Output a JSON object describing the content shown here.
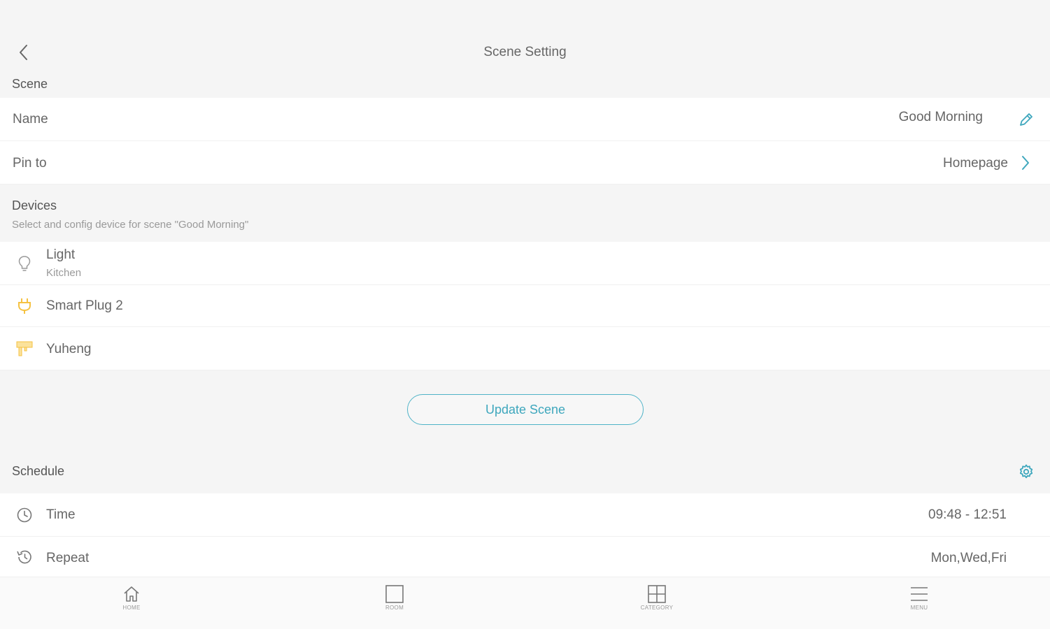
{
  "header": {
    "title": "Scene Setting"
  },
  "scene_section": {
    "label": "Scene",
    "name_label": "Name",
    "name_value": "Good Morning",
    "pin_label": "Pin to",
    "pin_value": "Homepage"
  },
  "devices_section": {
    "label": "Devices",
    "subtitle": "Select and config device for scene \"Good Morning\"",
    "items": [
      {
        "name": "Light",
        "sub": "Kitchen",
        "icon": "bulb-icon"
      },
      {
        "name": "Smart Plug 2",
        "icon": "plug-icon"
      },
      {
        "name": "Yuheng",
        "icon": "strip-icon"
      }
    ]
  },
  "update_button": {
    "label": "Update Scene"
  },
  "schedule_section": {
    "label": "Schedule",
    "time_label": "Time",
    "time_value": "09:48 - 12:51",
    "repeat_label": "Repeat",
    "repeat_value": "Mon,Wed,Fri"
  },
  "tabs": [
    {
      "label": "HOME",
      "icon": "home-icon"
    },
    {
      "label": "ROOM",
      "icon": "room-icon"
    },
    {
      "label": "CATEGORY",
      "icon": "category-icon"
    },
    {
      "label": "MENU",
      "icon": "menu-icon"
    }
  ],
  "colors": {
    "accent": "#3ea7bd",
    "plug": "#f5c242"
  }
}
